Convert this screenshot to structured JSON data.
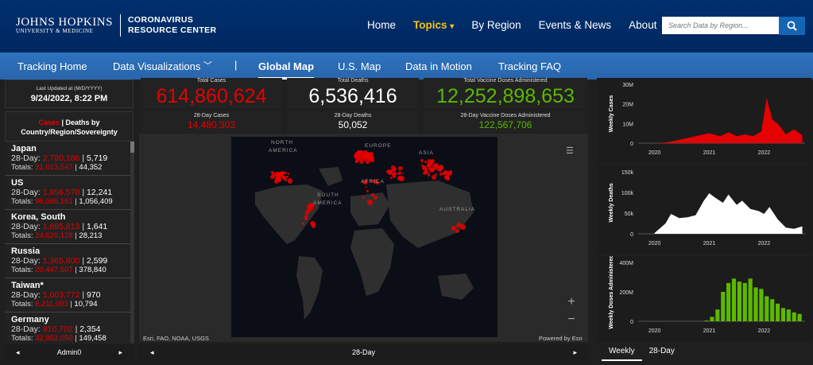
{
  "header": {
    "logo_line1": "JOHNS HOPKINS",
    "logo_line2": "UNIVERSITY & MEDICINE",
    "crc_line1": "CORONAVIRUS",
    "crc_line2": "RESOURCE CENTER",
    "nav": [
      "Home",
      "Topics",
      "By Region",
      "Events & News",
      "About"
    ],
    "topics_caret": "▾",
    "search_placeholder": "Search Data by Region..."
  },
  "subnav": {
    "items": [
      "Tracking Home",
      "Data Visualizations",
      "Global Map",
      "U.S. Map",
      "Data in Motion",
      "Tracking FAQ"
    ],
    "caret": "﹀",
    "divider": "|"
  },
  "updated": {
    "label": "Last Updated at (M/D/YYYY)",
    "value": "9/24/2022, 8:22 PM"
  },
  "list": {
    "header_cases": "Cases",
    "header_sep": " | ",
    "header_deaths": "Deaths by",
    "header_line2": "Country/Region/Sovereignty",
    "day_prefix": "28-Day: ",
    "totals_prefix": "Totals: ",
    "sep": " | ",
    "items": [
      {
        "name": "Japan",
        "d_cases": "2,780,186",
        "d_deaths": "5,719",
        "t_cases": "21,013,547",
        "t_deaths": "44,352"
      },
      {
        "name": "US",
        "d_cases": "1,856,578",
        "d_deaths": "12,241",
        "t_cases": "96,065,161",
        "t_deaths": "1,056,409"
      },
      {
        "name": "Korea, South",
        "d_cases": "1,695,813",
        "d_deaths": "1,641",
        "t_cases": "24,620,128",
        "t_deaths": "28,213"
      },
      {
        "name": "Russia",
        "d_cases": "1,365,800",
        "d_deaths": "2,599",
        "t_cases": "20,447,507",
        "t_deaths": "378,840"
      },
      {
        "name": "Taiwan*",
        "d_cases": "1,003,772",
        "d_deaths": "970",
        "t_cases": "6,211,093",
        "t_deaths": "10,794"
      },
      {
        "name": "Germany",
        "d_cases": "910,702",
        "d_deaths": "2,354",
        "t_cases": "32,952,050",
        "t_deaths": "149,458"
      }
    ]
  },
  "footer": {
    "left_label": "Admin0",
    "mid_label": "28-Day",
    "prev": "◂",
    "next": "▸"
  },
  "stats": {
    "total_cases_label": "Total Cases",
    "total_cases": "614,860,624",
    "total_deaths_label": "Total Deaths",
    "total_deaths": "6,536,416",
    "total_vacc_label": "Total Vaccine Doses Administered",
    "total_vacc": "12,252,898,653",
    "d_cases_label": "28-Day Cases",
    "d_cases": "14,480,303",
    "d_deaths_label": "28-Day Deaths",
    "d_deaths": "50,052",
    "d_vacc_label": "28-Day Vaccine Doses Administered",
    "d_vacc": "122,567,706"
  },
  "map": {
    "labels": [
      "NORTH",
      "AMERICA",
      "EUROPE",
      "ASIA",
      "AFRICA",
      "SOUTH",
      "AMERICA",
      "AUSTRALIA"
    ],
    "attribution_left": "Esri, FAO, NOAA, USGS",
    "attribution_right": "Powered by Esri",
    "zoom_in": "+",
    "zoom_out": "−",
    "list_icon": "☰"
  },
  "colors": {
    "cases": "#e60000",
    "deaths": "#ffffff",
    "vaccines": "#5cb800"
  },
  "chart_data": [
    {
      "type": "area",
      "ylabel": "Weekly Cases",
      "yticks": [
        "30M",
        "20M",
        "10M",
        "0"
      ],
      "ylim": [
        0,
        30
      ],
      "y_unit": "M",
      "xticks": [
        "2020",
        "2021",
        "2022"
      ],
      "x": [
        2020.0,
        2020.25,
        2020.5,
        2020.75,
        2020.9,
        2021.0,
        2021.2,
        2021.35,
        2021.5,
        2021.65,
        2021.8,
        2021.95,
        2022.05,
        2022.15,
        2022.25,
        2022.4,
        2022.55,
        2022.7
      ],
      "values": [
        0,
        0.5,
        2,
        3.5,
        4.5,
        5,
        3.5,
        5.5,
        3.5,
        4.5,
        3.5,
        6,
        23,
        12,
        10,
        4.5,
        7,
        4
      ]
    },
    {
      "type": "area",
      "ylabel": "Weekly Deaths",
      "yticks": [
        "150k",
        "100k",
        "50k",
        "0"
      ],
      "ylim": [
        0,
        150
      ],
      "y_unit": "k",
      "xticks": [
        "2020",
        "2021",
        "2022"
      ],
      "x": [
        2020.0,
        2020.2,
        2020.3,
        2020.45,
        2020.6,
        2020.75,
        2020.9,
        2021.0,
        2021.1,
        2021.25,
        2021.35,
        2021.5,
        2021.6,
        2021.75,
        2021.9,
        2022.0,
        2022.1,
        2022.25,
        2022.4,
        2022.55,
        2022.7
      ],
      "values": [
        2,
        25,
        48,
        38,
        40,
        45,
        80,
        98,
        88,
        75,
        95,
        70,
        80,
        60,
        55,
        48,
        65,
        35,
        15,
        12,
        18
      ]
    },
    {
      "type": "bar",
      "ylabel": "Weekly Doses Administered",
      "yticks": [
        "400M",
        "200M",
        "0"
      ],
      "ylim": [
        0,
        400
      ],
      "y_unit": "M",
      "xticks": [
        "2020",
        "2021",
        "2022"
      ],
      "x": [
        2020.95,
        2021.05,
        2021.15,
        2021.25,
        2021.35,
        2021.45,
        2021.55,
        2021.65,
        2021.75,
        2021.85,
        2021.95,
        2022.05,
        2022.15,
        2022.25,
        2022.35,
        2022.45,
        2022.55,
        2022.65
      ],
      "values": [
        5,
        30,
        80,
        200,
        260,
        290,
        270,
        260,
        290,
        230,
        220,
        170,
        150,
        120,
        90,
        80,
        60,
        50
      ]
    }
  ],
  "tabs": [
    "Weekly",
    "28-Day"
  ]
}
